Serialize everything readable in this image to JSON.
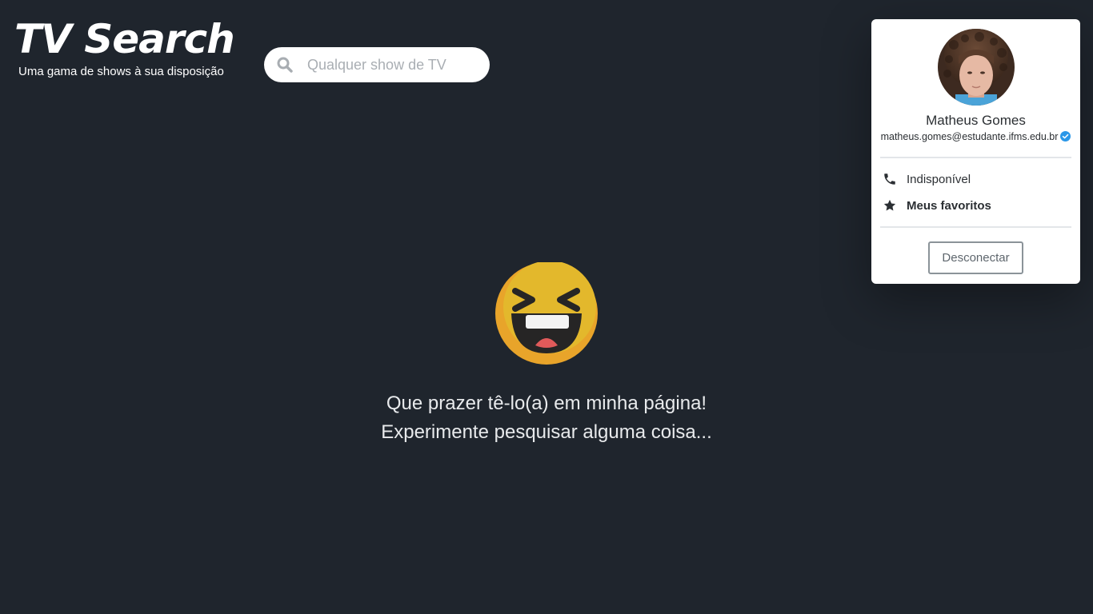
{
  "header": {
    "title": "TV Search",
    "subtitle": "Uma gama de shows à sua disposição"
  },
  "search": {
    "placeholder": "Qualquer show de TV",
    "value": ""
  },
  "profile": {
    "name": "Matheus Gomes",
    "email": "matheus.gomes@estudante.ifms.edu.br",
    "menu": [
      {
        "icon": "phone-icon",
        "label": "Indisponível"
      },
      {
        "icon": "star-icon",
        "label": "Meus favoritos"
      }
    ],
    "logout_label": "Desconectar"
  },
  "main": {
    "emoji": "laughing-face-icon",
    "message_line1": "Que prazer tê-lo(a) em minha página!",
    "message_line2": "Experimente pesquisar alguma coisa..."
  },
  "colors": {
    "background": "#1f252d",
    "verified": "#2a97e8",
    "emoji_yellow": "#e3b82c"
  }
}
